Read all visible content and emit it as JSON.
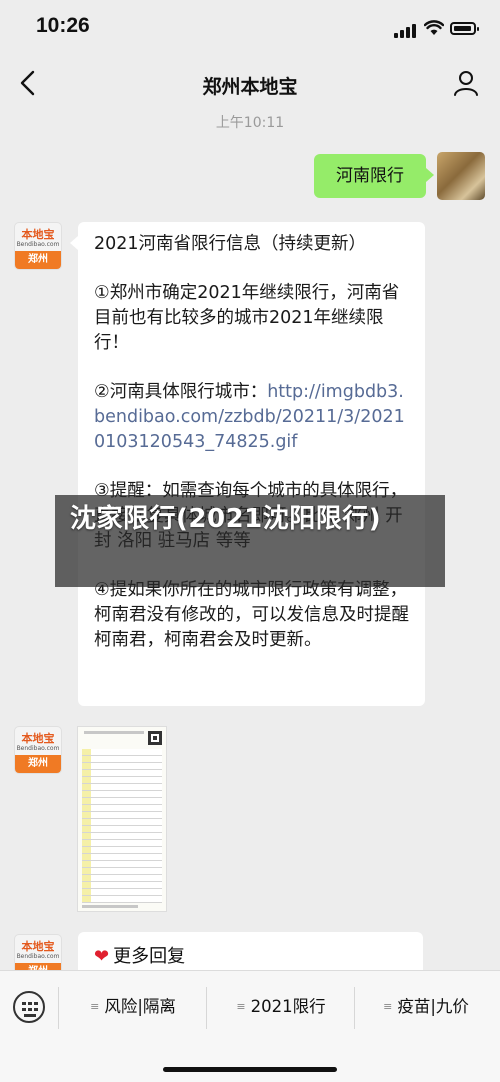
{
  "status_bar": {
    "time": "10:26"
  },
  "nav": {
    "title": "郑州本地宝"
  },
  "timestamp": "上午10:11",
  "sent_message": {
    "text": "河南限行"
  },
  "account_avatar": {
    "logo": "本地宝",
    "site": "Bendibao.com",
    "city": "郑州"
  },
  "info_message": {
    "p1": "2021河南省限行信息（持续更新）",
    "p2": "①郑州市确定2021年继续限行，河南省目前也有比较多的城市2021年继续限行！",
    "p3_prefix": "②河南具体限行城市：",
    "p3_link": "http://imgbdb3.bendibao.com/zzbdb/20211/3/20210103120543_74825.gif",
    "p4": "③提醒：如需查询每个城市的具体限行，直接回复具体城市名即可。比如 郑州 开封 洛阳 驻马店 等等",
    "p5": "④提如果你所在的城市限行政策有调整，柯南君没有修改的，可以发信息及时提醒柯南君，柯南君会及时更新。"
  },
  "more_message": {
    "text": "更多回复"
  },
  "overlay": {
    "text": "沈家限行(2021沈阳限行)"
  },
  "bottom_menu": {
    "items": [
      {
        "label": "风险|隔离"
      },
      {
        "label": "2021限行"
      },
      {
        "label": "疫苗|九价"
      }
    ]
  }
}
